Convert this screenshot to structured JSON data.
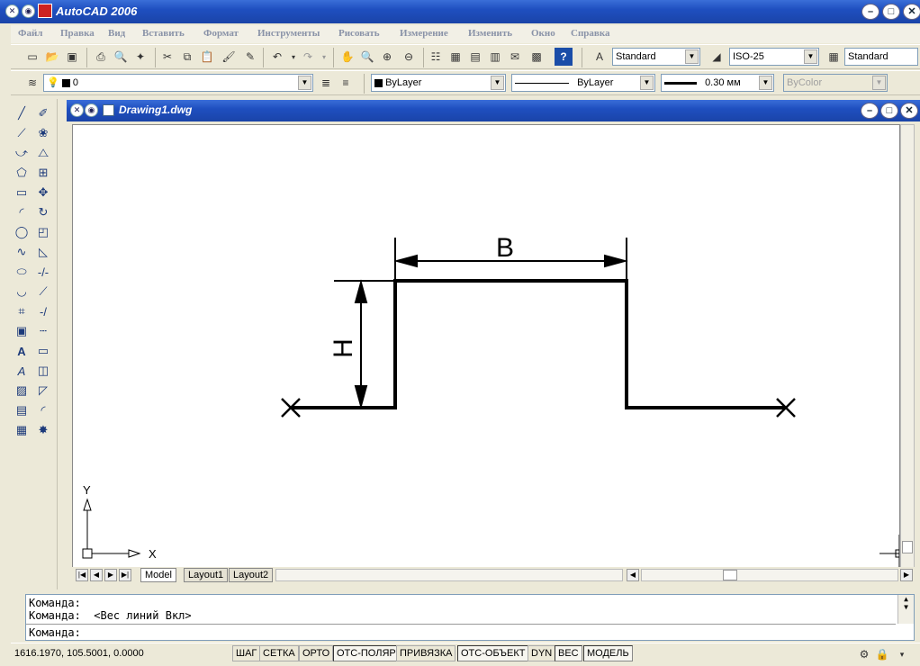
{
  "app": {
    "title": "AutoCAD 2006"
  },
  "menu": [
    "Файл",
    "Правка",
    "Вид",
    "Вставить",
    "Формат",
    "Инструменты",
    "Рисовать",
    "Измерение",
    "Изменить",
    "Окно",
    "Справка"
  ],
  "styles": {
    "text_style": "Standard",
    "dim_style": "ISO-25",
    "table_style": "Standard"
  },
  "layers": {
    "current_layer": "0",
    "color": "ByLayer",
    "linetype": "ByLayer",
    "lineweight": "0.30 мм",
    "plot_style": "ByColor"
  },
  "drawing": {
    "title": "Drawing1.dwg",
    "dim_width_label": "B",
    "dim_height_label": "H",
    "ucs_x": "X",
    "ucs_y": "Y"
  },
  "tabs": [
    "Model",
    "Layout1",
    "Layout2"
  ],
  "command": {
    "line1": "Команда:",
    "line2": "Команда:  <Вес линий Вкл>",
    "line3": "Команда:"
  },
  "status": {
    "coords": "1616.1970, 105.5001, 0.0000",
    "buttons": [
      "ШАГ",
      "СЕТКА",
      "ОРТО",
      "ОТС-ПОЛЯР",
      "ПРИВЯЗКА",
      "ОТС-ОБЪЕКТ",
      "DYN",
      "ВЕС",
      "МОДЕЛЬ"
    ],
    "active": [
      "ОТС-ПОЛЯР",
      "ОТС-ОБЪЕКТ",
      "ВЕС",
      "МОДЕЛЬ"
    ]
  },
  "colors": {
    "titlebar": "#1f4fc0",
    "canvas": "#ffffff",
    "menu_text": "#8a93a8"
  }
}
